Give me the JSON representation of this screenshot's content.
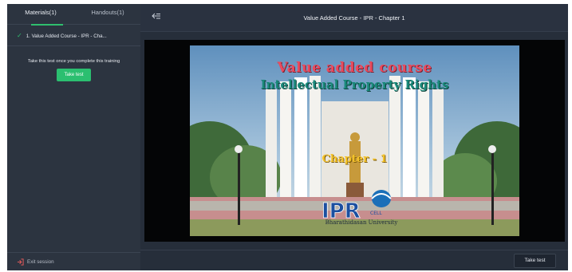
{
  "sidebar": {
    "tabs": [
      {
        "label": "Materials(1)"
      },
      {
        "label": "Handouts(1)"
      }
    ],
    "material_item": {
      "label": "1. Value Added Course - IPR - Cha..."
    },
    "take_test_note": "Take this test once you complete this training",
    "take_test_button": "Take test",
    "exit_label": "Exit session"
  },
  "header": {
    "title": "Value Added Course - IPR - Chapter 1"
  },
  "slide": {
    "line1": "Value added course",
    "line2": "Intellectual Property Rights",
    "line3": "Chapter - 1",
    "logo_text": "IPR",
    "logo_cell": "CELL",
    "caption": "Bharathidasan University"
  },
  "footer": {
    "take_test_button": "Take test"
  },
  "colors": {
    "accent": "#2bbf70",
    "sidebar_bg": "#2c3440",
    "main_bg": "#262e3a",
    "exit_red": "#e05a5a"
  },
  "icons": {
    "check": "check-icon",
    "collapse": "collapse-sidebar-icon",
    "exit": "exit-session-icon"
  }
}
